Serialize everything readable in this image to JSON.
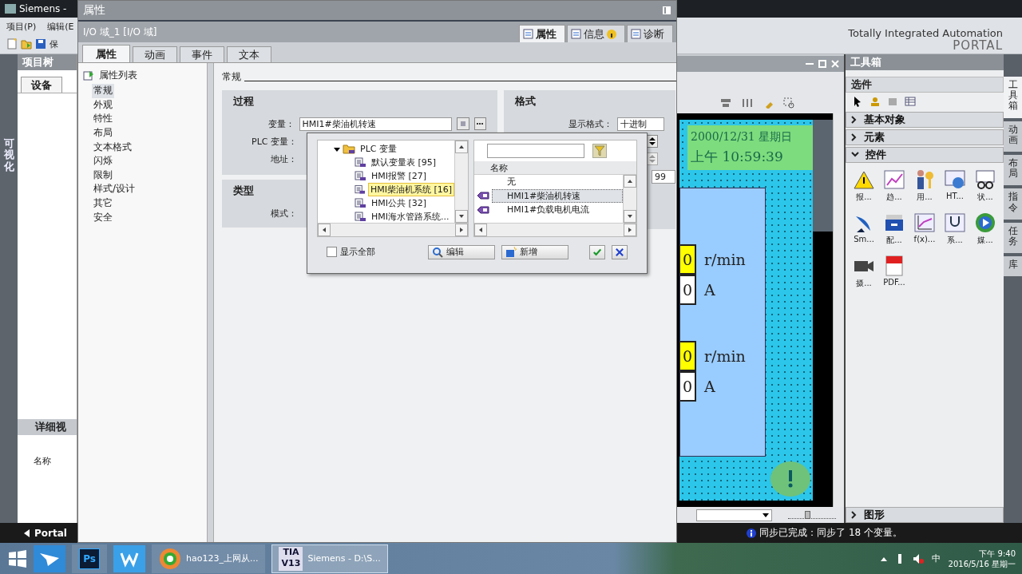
{
  "app": {
    "title": "Siemens -",
    "menu": [
      "项目(P)",
      "编辑(E"
    ],
    "toolbar_label": "保",
    "brand": "Totally Integrated Automation",
    "brand_sub": "PORTAL",
    "side_strip": "可视化"
  },
  "project_tree": {
    "title": "项目树",
    "tab": "设备",
    "detail_title": "详细视",
    "detail_column": "名称"
  },
  "zoom": {
    "level": 0.4
  },
  "hmi_screen": {
    "date": "2000/12/31 星期日",
    "time": "上午 10:59:39",
    "gauges": [
      {
        "readings": [
          {
            "value": "0",
            "unit": "r/min",
            "highlighted": true
          },
          {
            "value": "0",
            "unit": "A",
            "highlighted": false
          }
        ]
      },
      {
        "readings": [
          {
            "value": "0",
            "unit": "r/min",
            "highlighted": true
          },
          {
            "value": "0",
            "unit": "A",
            "highlighted": false
          }
        ]
      }
    ]
  },
  "toolbox": {
    "title": "工具箱",
    "options_title": "选件",
    "sections": [
      {
        "label": "基本对象",
        "expanded": false
      },
      {
        "label": "元素",
        "expanded": false
      },
      {
        "label": "控件",
        "expanded": true,
        "items": [
          "报...",
          "趋...",
          "用...",
          "HT...",
          "状...",
          "Sm...",
          "配...",
          "f(x)...",
          "系...",
          "媒...",
          "摄...",
          "PDF..."
        ]
      },
      {
        "label": "图形",
        "expanded": false
      }
    ]
  },
  "side_tabs": [
    {
      "label": "工具箱",
      "selected": true
    },
    {
      "label": "动画",
      "selected": false
    },
    {
      "label": "布局",
      "selected": false
    },
    {
      "label": "指令",
      "selected": false
    },
    {
      "label": "任务",
      "selected": false
    },
    {
      "label": "库",
      "selected": false
    }
  ],
  "properties": {
    "title": "属性",
    "object": "I/O 域_1 [I/O 域]",
    "inspector_tabs": [
      {
        "label": "属性",
        "selected": true
      },
      {
        "label": "信息",
        "selected": false
      },
      {
        "label": "诊断",
        "selected": false
      }
    ],
    "tabs": [
      {
        "label": "属性",
        "selected": true
      },
      {
        "label": "动画",
        "selected": false
      },
      {
        "label": "事件",
        "selected": false
      },
      {
        "label": "文本",
        "selected": false
      }
    ],
    "list_title": "属性列表",
    "nav": [
      {
        "label": "常规",
        "selected": true
      },
      {
        "label": "外观",
        "selected": false
      },
      {
        "label": "特性",
        "selected": false
      },
      {
        "label": "布局",
        "selected": false
      },
      {
        "label": "文本格式",
        "selected": false
      },
      {
        "label": "闪烁",
        "selected": false
      },
      {
        "label": "限制",
        "selected": false
      },
      {
        "label": "样式/设计",
        "selected": false
      },
      {
        "label": "其它",
        "selected": false
      },
      {
        "label": "安全",
        "selected": false
      }
    ],
    "section_title": "常规",
    "process": {
      "title": "过程",
      "fields": [
        {
          "label": "变量：",
          "value": "HMI1#柴油机转速"
        },
        {
          "label": "PLC 变量："
        },
        {
          "label": "地址："
        }
      ]
    },
    "format": {
      "title": "格式",
      "display_label": "显示格式：",
      "display_value": "十进制",
      "field_value": "99"
    },
    "type": {
      "title": "类型",
      "mode_label": "模式："
    }
  },
  "tag_picker": {
    "tree": [
      {
        "label": "PLC 变量",
        "expanded": true,
        "children": [
          {
            "label": "默认变量表 [95]",
            "selected": false
          },
          {
            "label": "HMI报警 [27]",
            "selected": false
          },
          {
            "label": "HMI柴油机系统 [16]",
            "selected": true
          },
          {
            "label": "HMI公共 [32]",
            "selected": false
          },
          {
            "label": "HMI海水管路系统...",
            "selected": false
          }
        ]
      }
    ],
    "column": "名称",
    "rows": [
      {
        "label": "无",
        "kind": "none",
        "selected": false
      },
      {
        "label": "HMI1#柴油机转速",
        "kind": "tag",
        "selected": true
      },
      {
        "label": "HMI1#负载电机电流",
        "kind": "tag",
        "selected": false
      }
    ],
    "show_all": {
      "label": "显示全部",
      "checked": false
    },
    "buttons": [
      {
        "kind": "edit",
        "label": "编辑"
      },
      {
        "kind": "add",
        "label": "新增"
      },
      {
        "kind": "confirm"
      },
      {
        "kind": "cancel"
      }
    ]
  },
  "status_bar": {
    "portal_label": "Portal",
    "message": "同步已完成：同步了 18 个变量。"
  },
  "taskbar": {
    "apps": [
      {
        "kind": "ps",
        "label": "Ps",
        "active": false
      },
      {
        "kind": "browser",
        "label": "hao123_上网从...",
        "active": false
      },
      {
        "kind": "tia",
        "badge_top": "TIA",
        "badge_bottom": "V13",
        "label": "Siemens  -  D:\\S...",
        "active": true
      }
    ],
    "ime": "中",
    "time": "下午 9:40",
    "date": "2016/5/16 星期一"
  }
}
